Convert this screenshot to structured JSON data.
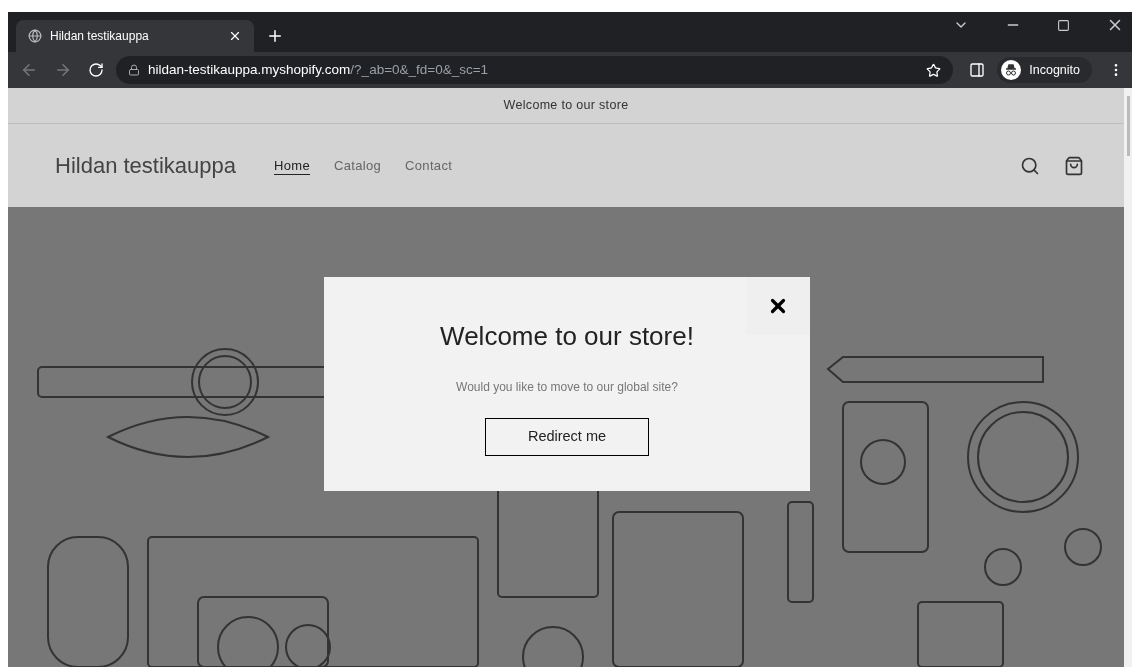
{
  "browser": {
    "tab": {
      "title": "Hildan testikauppa",
      "selected": true
    },
    "url": {
      "host": "hildan-testikauppa.myshopify.com",
      "path": "/?_ab=0&_fd=0&_sc=1"
    },
    "profile": "Incognito"
  },
  "announcement": "Welcome to our store",
  "header": {
    "store_name": "Hildan testikauppa",
    "nav": [
      {
        "label": "Home",
        "selected": true
      },
      {
        "label": "Catalog",
        "selected": false
      },
      {
        "label": "Contact",
        "selected": false
      }
    ]
  },
  "modal": {
    "title": "Welcome to our store!",
    "message": "Would you like to move to our global site?",
    "button": "Redirect me"
  }
}
